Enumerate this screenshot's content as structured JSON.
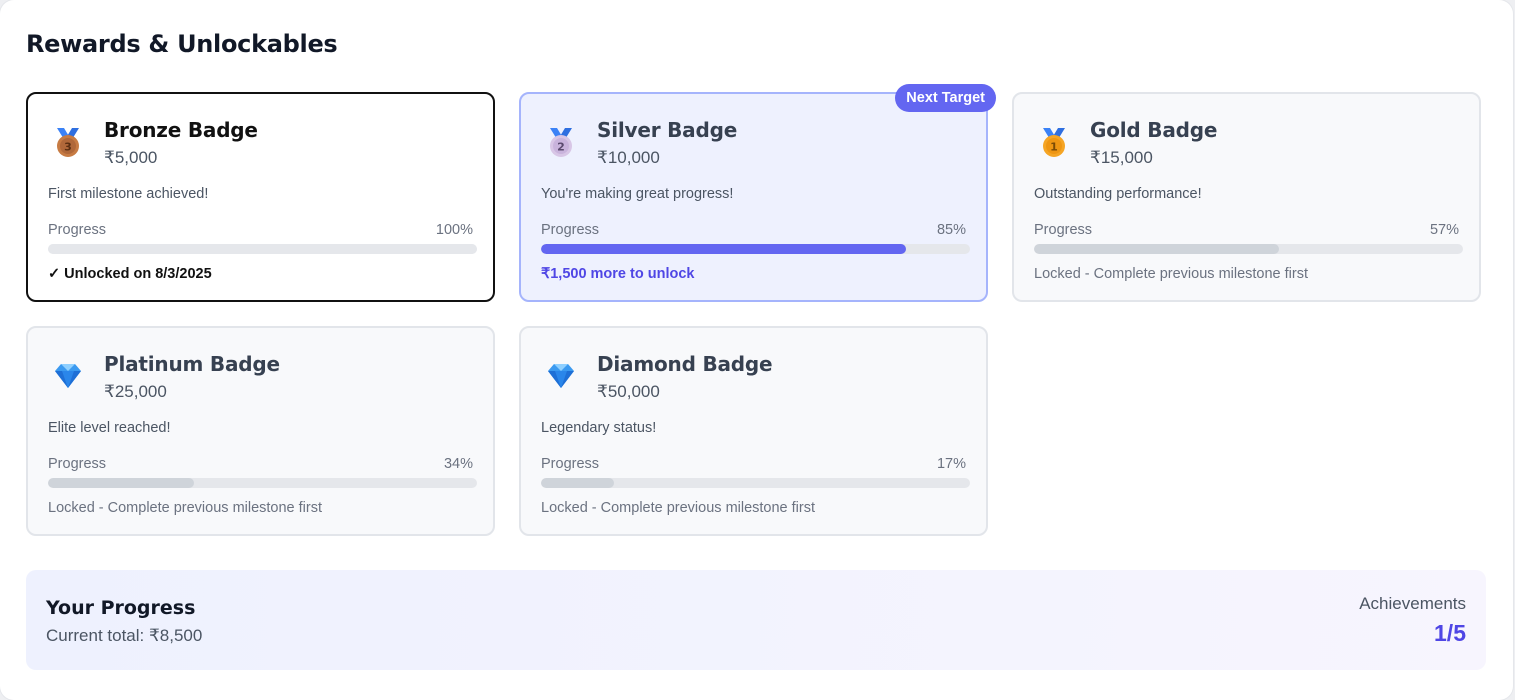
{
  "title": "Rewards & Unlockables",
  "next_tag": "Next Target",
  "progress_label": "Progress",
  "badges": [
    {
      "name": "Bronze Badge",
      "amount": "₹5,000",
      "description": "First milestone achieved!",
      "progress_text": "100%",
      "progress": 1.0,
      "status": "✓ Unlocked on 8/3/2025",
      "icon": "bronze-medal-icon",
      "state": "unlocked"
    },
    {
      "name": "Silver Badge",
      "amount": "₹10,000",
      "description": "You're making great progress!",
      "progress_text": "85%",
      "progress": 0.85,
      "status": "₹1,500 more to unlock",
      "icon": "silver-medal-icon",
      "state": "next"
    },
    {
      "name": "Gold Badge",
      "amount": "₹15,000",
      "description": "Outstanding performance!",
      "progress_text": "57%",
      "progress": 0.57,
      "status": "Locked - Complete previous milestone first",
      "icon": "gold-medal-icon",
      "state": "locked"
    },
    {
      "name": "Platinum Badge",
      "amount": "₹25,000",
      "description": "Elite level reached!",
      "progress_text": "34%",
      "progress": 0.34,
      "status": "Locked - Complete previous milestone first",
      "icon": "diamond-icon",
      "state": "locked"
    },
    {
      "name": "Diamond Badge",
      "amount": "₹50,000",
      "description": "Legendary status!",
      "progress_text": "17%",
      "progress": 0.17,
      "status": "Locked - Complete previous milestone first",
      "icon": "diamond-icon",
      "state": "locked"
    }
  ],
  "summary": {
    "title": "Your Progress",
    "current_total": "Current total: ₹8,500",
    "achievements_label": "Achievements",
    "achievements_count": "1/5"
  },
  "colors": {
    "accent": "#6366f1",
    "accent_text": "#4f46e5",
    "locked_fill": "#cfd4da",
    "bronze": "#c77b43",
    "silver": "#d8c6e6",
    "gold": "#f5a524",
    "ribbon": "#3b82f6"
  }
}
